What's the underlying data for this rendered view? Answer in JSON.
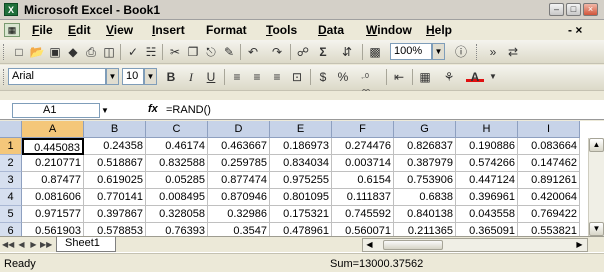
{
  "window": {
    "title": "Microsoft Excel - Book1",
    "icon_label": "X"
  },
  "menu": [
    {
      "first": "F",
      "rest": "ile"
    },
    {
      "first": "E",
      "rest": "dit"
    },
    {
      "first": "V",
      "rest": "iew"
    },
    {
      "first": "I",
      "rest": "nsert"
    },
    {
      "first": "",
      "rest": "Format"
    },
    {
      "first": "T",
      "rest": "ools"
    },
    {
      "first": "D",
      "rest": "ata"
    },
    {
      "first": "W",
      "rest": "indow"
    },
    {
      "first": "H",
      "rest": "elp"
    }
  ],
  "help_box": "- ×",
  "standard_toolbar": {
    "zoom": "100%",
    "sigma": "Σ"
  },
  "format_toolbar": {
    "font": "Arial",
    "size": "10",
    "bold": "B",
    "italic": "I",
    "underline": "U",
    "currency": "$",
    "percent": "%",
    "decimals": ",.0 .00",
    "color_letter": "A"
  },
  "formula_bar": {
    "name_box": "A1",
    "fx": "fx",
    "formula": "=RAND()"
  },
  "columns": [
    "A",
    "B",
    "C",
    "D",
    "E",
    "F",
    "G",
    "H",
    "I"
  ],
  "rows": [
    {
      "n": "1",
      "cells": [
        "0.445083",
        "0.24358",
        "0.46174",
        "0.463667",
        "0.186973",
        "0.274476",
        "0.826837",
        "0.190886",
        "0.083664"
      ]
    },
    {
      "n": "2",
      "cells": [
        "0.210771",
        "0.518867",
        "0.832588",
        "0.259785",
        "0.834034",
        "0.003714",
        "0.387979",
        "0.574266",
        "0.147462"
      ]
    },
    {
      "n": "3",
      "cells": [
        "0.87477",
        "0.619025",
        "0.05285",
        "0.877474",
        "0.975255",
        "0.6154",
        "0.753906",
        "0.447124",
        "0.891261"
      ]
    },
    {
      "n": "4",
      "cells": [
        "0.081606",
        "0.770141",
        "0.008495",
        "0.870946",
        "0.801095",
        "0.111837",
        "0.6838",
        "0.396961",
        "0.420064"
      ]
    },
    {
      "n": "5",
      "cells": [
        "0.971577",
        "0.397867",
        "0.328058",
        "0.32986",
        "0.175321",
        "0.745592",
        "0.840138",
        "0.043558",
        "0.769422"
      ]
    },
    {
      "n": "6",
      "cells": [
        "0.561903",
        "0.578853",
        "0.76393",
        "0.3547",
        "0.478961",
        "0.560071",
        "0.211365",
        "0.365091",
        "0.553821"
      ]
    }
  ],
  "sheet_tab": "Sheet1",
  "status": {
    "ready": "Ready",
    "sum": "Sum=13000.37562"
  },
  "colors": {
    "header_blue": "#c7d3e8",
    "excel_green": "#1f6f3a"
  }
}
